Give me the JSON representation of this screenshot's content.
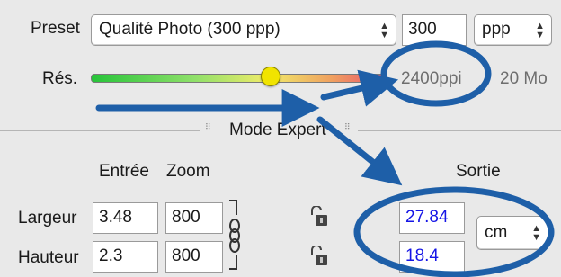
{
  "preset": {
    "label": "Preset",
    "value": "Qualité Photo (300 ppp)",
    "number": "300",
    "unit": "ppp"
  },
  "resolution": {
    "label": "Rés.",
    "slider_fraction": 0.61,
    "value_text": "2400ppi",
    "size_text": "20 Mo"
  },
  "expert": {
    "label": "Mode Expert",
    "headers": {
      "input": "Entrée",
      "zoom": "Zoom",
      "output": "Sortie"
    },
    "width": {
      "label": "Largeur",
      "input": "3.48",
      "zoom": "800",
      "output": "27.84"
    },
    "height": {
      "label": "Hauteur",
      "input": "2.3",
      "zoom": "800",
      "output": "18.4"
    },
    "unit": "cm"
  },
  "colors": {
    "annotation": "#1e5fa8",
    "output_text": "#1515e6"
  },
  "icons": [
    "chain-link-icon",
    "padlock-icon",
    "select-arrows-icon",
    "grip-icon"
  ]
}
